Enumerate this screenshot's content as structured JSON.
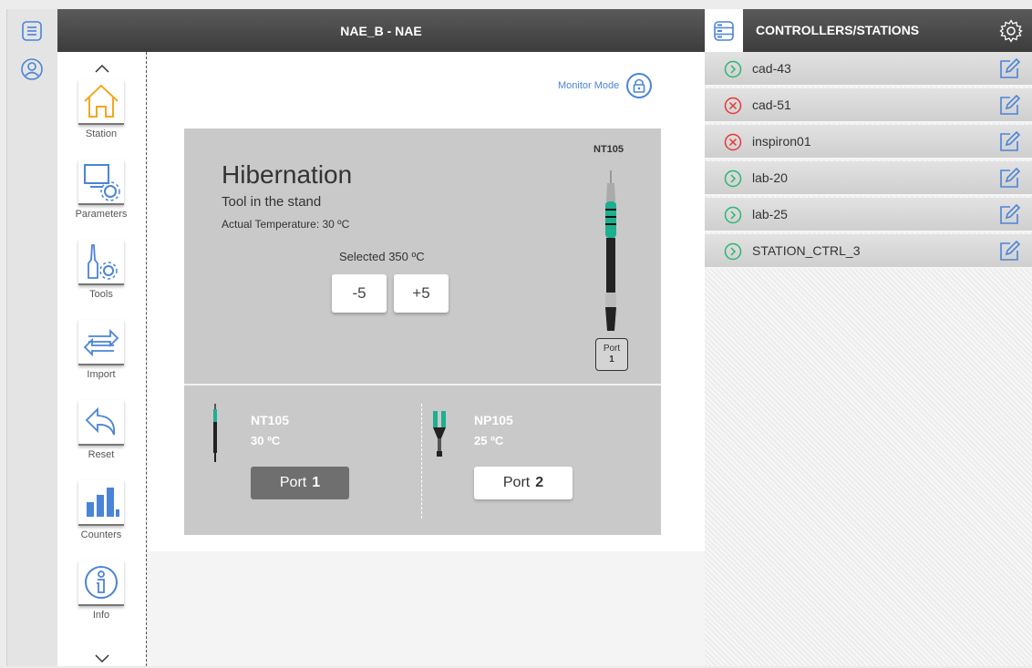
{
  "header": {
    "title": "NAE_B - NAE"
  },
  "nav": {
    "items": [
      {
        "label": "Station",
        "icon": "house-icon",
        "active": true
      },
      {
        "label": "Parameters",
        "icon": "monitor-gear-icon"
      },
      {
        "label": "Tools",
        "icon": "tool-gear-icon"
      },
      {
        "label": "Import",
        "icon": "arrows-exchange-icon"
      },
      {
        "label": "Reset",
        "icon": "undo-arrow-icon"
      },
      {
        "label": "Counters",
        "icon": "bar-chart-icon"
      },
      {
        "label": "Info",
        "icon": "info-icon"
      }
    ]
  },
  "monitor": {
    "label": "Monitor Mode"
  },
  "station": {
    "model": "NT105",
    "status": "Hibernation",
    "substatus": "Tool in the stand",
    "actual_temp": "Actual Temperature: 30 ºC",
    "selected": "Selected 350 ºC",
    "minus_label": "-5",
    "plus_label": "+5",
    "port_label": "Port",
    "port_number": "1"
  },
  "ports": [
    {
      "tool": "NT105",
      "temp": "30 ºC",
      "port_label": "Port",
      "port_number": "1",
      "selected": true
    },
    {
      "tool": "NP105",
      "temp": "25 ºC",
      "port_label": "Port",
      "port_number": "2",
      "selected": false
    }
  ],
  "right_panel": {
    "title": "CONTROLLERS/STATIONS",
    "controllers": [
      {
        "name": "cad-43",
        "status": "ok"
      },
      {
        "name": "cad-51",
        "status": "error"
      },
      {
        "name": "inspiron01",
        "status": "error"
      },
      {
        "name": "lab-20",
        "status": "ok"
      },
      {
        "name": "lab-25",
        "status": "ok"
      },
      {
        "name": "STATION_CTRL_3",
        "status": "ok"
      }
    ]
  },
  "colors": {
    "accent_blue": "#4a84d8",
    "ok_green": "#2bb673",
    "error_red": "#e53935",
    "active_orange": "#f5a623",
    "tool_teal": "#1fae8f"
  }
}
